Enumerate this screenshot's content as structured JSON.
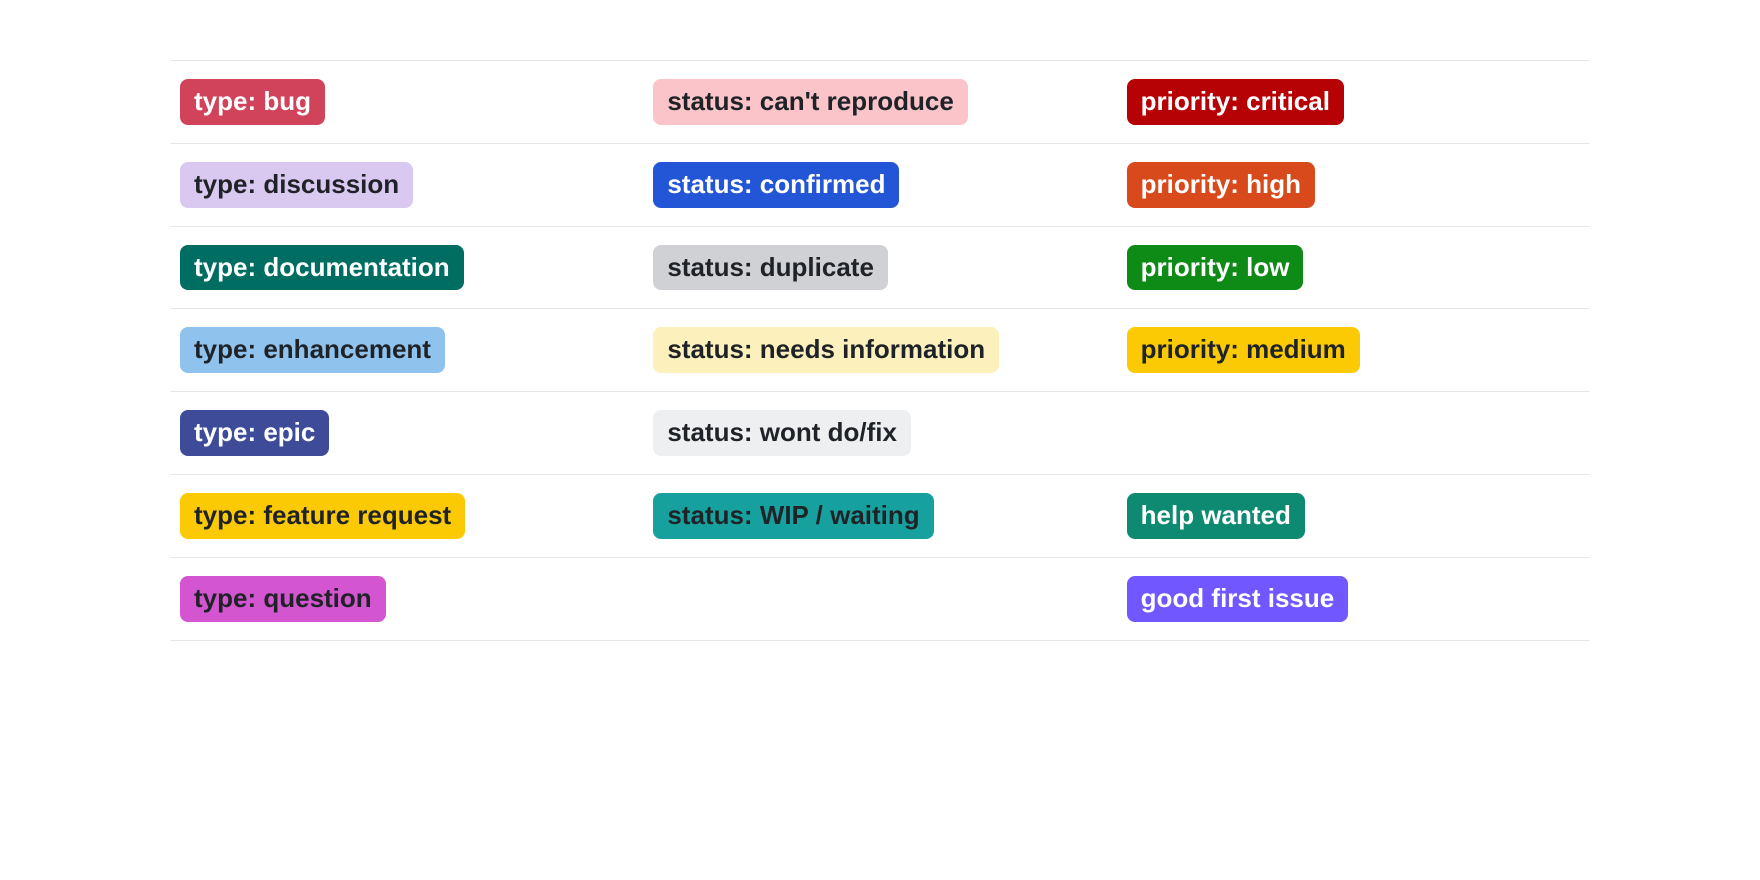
{
  "rows": [
    {
      "c0": {
        "text": "type: bug",
        "bg": "#d1435b",
        "fg": "#ffffff"
      },
      "c1": {
        "text": "status: can't reproduce",
        "bg": "#fbc4c8",
        "fg": "#1f2328"
      },
      "c2": {
        "text": "priority: critical",
        "bg": "#b60205",
        "fg": "#ffffff"
      }
    },
    {
      "c0": {
        "text": "type: discussion",
        "bg": "#d9c8f0",
        "fg": "#1f2328"
      },
      "c1": {
        "text": "status: confirmed",
        "bg": "#2355d7",
        "fg": "#ffffff"
      },
      "c2": {
        "text": "priority: high",
        "bg": "#d84a1b",
        "fg": "#ffffff"
      }
    },
    {
      "c0": {
        "text": "type: documentation",
        "bg": "#006d63",
        "fg": "#ffffff"
      },
      "c1": {
        "text": "status: duplicate",
        "bg": "#cfd1d4",
        "fg": "#1f2328"
      },
      "c2": {
        "text": "priority: low",
        "bg": "#0e8a16",
        "fg": "#ffffff"
      }
    },
    {
      "c0": {
        "text": "type: enhancement",
        "bg": "#8fc3ee",
        "fg": "#1f2328"
      },
      "c1": {
        "text": "status: needs information",
        "bg": "#fcf0bc",
        "fg": "#1f2328"
      },
      "c2": {
        "text": "priority: medium",
        "bg": "#fbca04",
        "fg": "#1f2328"
      }
    },
    {
      "c0": {
        "text": "type: epic",
        "bg": "#3e4b99",
        "fg": "#ffffff"
      },
      "c1": {
        "text": "status: wont do/fix",
        "bg": "#eeeff1",
        "fg": "#1f2328"
      },
      "c2": null
    },
    {
      "c0": {
        "text": "type: feature request",
        "bg": "#fbca04",
        "fg": "#1f2328"
      },
      "c1": {
        "text": "status: WIP / waiting",
        "bg": "#17a19e",
        "fg": "#1f2328"
      },
      "c2": {
        "text": "help wanted",
        "bg": "#0e8a72",
        "fg": "#ffffff"
      }
    },
    {
      "c0": {
        "text": "type: question",
        "bg": "#d355d0",
        "fg": "#1f2328"
      },
      "c1": null,
      "c2": {
        "text": "good first issue",
        "bg": "#7057ff",
        "fg": "#ffffff"
      }
    }
  ]
}
